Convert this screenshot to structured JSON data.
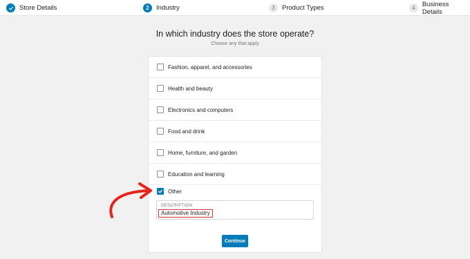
{
  "stepper": {
    "steps": [
      {
        "number": "",
        "label": "Store Details",
        "state": "done"
      },
      {
        "number": "2",
        "label": "Industry",
        "state": "active"
      },
      {
        "number": "3",
        "label": "Product Types",
        "state": "pending"
      },
      {
        "number": "4",
        "label": "Business Details",
        "state": "pending"
      }
    ]
  },
  "main": {
    "title": "In which industry does the store operate?",
    "subtitle": "Choose any that apply",
    "options": [
      {
        "label": "Fashion, apparel, and accessories",
        "checked": false
      },
      {
        "label": "Health and beauty",
        "checked": false
      },
      {
        "label": "Electronics and computers",
        "checked": false
      },
      {
        "label": "Food and drink",
        "checked": false
      },
      {
        "label": "Home, furniture, and garden",
        "checked": false
      },
      {
        "label": "Education and learning",
        "checked": false
      },
      {
        "label": "Other",
        "checked": true
      }
    ],
    "description": {
      "label": "DESCRIPTION",
      "value": "Automotive Industry"
    },
    "continue_label": "Continue"
  },
  "colors": {
    "accent": "#007cba",
    "annotation_red": "#e8231b",
    "background": "#f1f1f1"
  }
}
